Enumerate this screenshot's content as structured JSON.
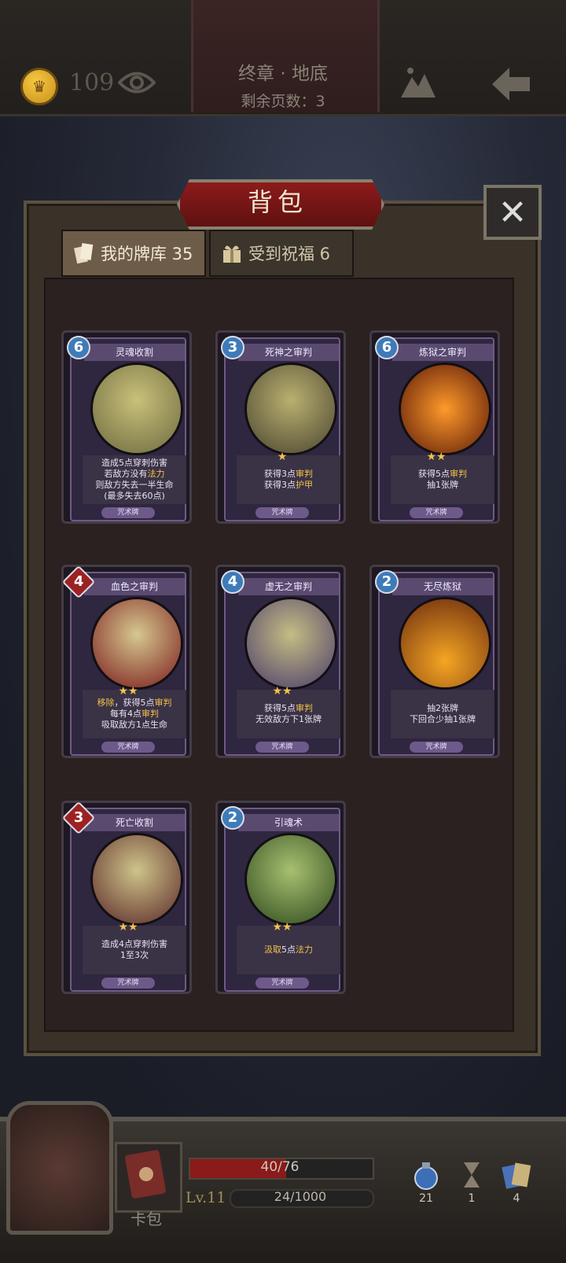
{
  "header": {
    "gold": "109",
    "chapter_title": "终章 · 地底",
    "pages_left": "剩余页数：3"
  },
  "panel": {
    "title": "背包",
    "close": "✕",
    "tabs": [
      {
        "label": "我的牌库 35"
      },
      {
        "label": "受到祝福 6"
      }
    ]
  },
  "cards": [
    {
      "cost": "6",
      "name": "灵魂收割",
      "stars": "",
      "desc": [
        "造成5点穿刺伤害",
        "若敌方没有法力",
        "则敌方失去一半生命",
        "(最多失去60点)"
      ],
      "type": "咒术牌"
    },
    {
      "cost": "3",
      "name": "死神之审判",
      "stars": "★",
      "desc": [
        "获得3点审判",
        "获得3点护甲"
      ],
      "type": "咒术牌"
    },
    {
      "cost": "6",
      "name": "炼狱之审判",
      "stars": "★★",
      "desc": [
        "获得5点审判",
        "抽1张牌"
      ],
      "type": "咒术牌"
    },
    {
      "cost": "4",
      "name": "血色之审判",
      "stars": "★★",
      "desc": [
        "移除，获得5点审判",
        "每有4点审判",
        "吸取敌方1点生命"
      ],
      "type": "咒术牌"
    },
    {
      "cost": "4",
      "name": "虚无之审判",
      "stars": "★★",
      "desc": [
        "获得5点审判",
        "无效敌方下1张牌"
      ],
      "type": "咒术牌"
    },
    {
      "cost": "2",
      "name": "无尽炼狱",
      "stars": "",
      "desc": [
        "抽2张牌",
        "下回合少抽1张牌"
      ],
      "type": "咒术牌"
    },
    {
      "cost": "3",
      "name": "死亡收割",
      "stars": "★★",
      "desc": [
        "造成4点穿刺伤害",
        "1至3次"
      ],
      "type": "咒术牌"
    },
    {
      "cost": "2",
      "name": "引魂术",
      "stars": "★★",
      "desc": [
        "汲取5点法力"
      ],
      "type": "咒术牌"
    }
  ],
  "hud": {
    "deck_label": "卡包",
    "hp_text": "40/76",
    "hp": 40,
    "hp_max": 76,
    "level": "Lv.11",
    "xp_text": "24/1000",
    "resources": [
      {
        "icon": "potion-icon",
        "count": "21"
      },
      {
        "icon": "hourglass-icon",
        "count": "1"
      },
      {
        "icon": "cards-icon",
        "count": "4"
      }
    ]
  }
}
